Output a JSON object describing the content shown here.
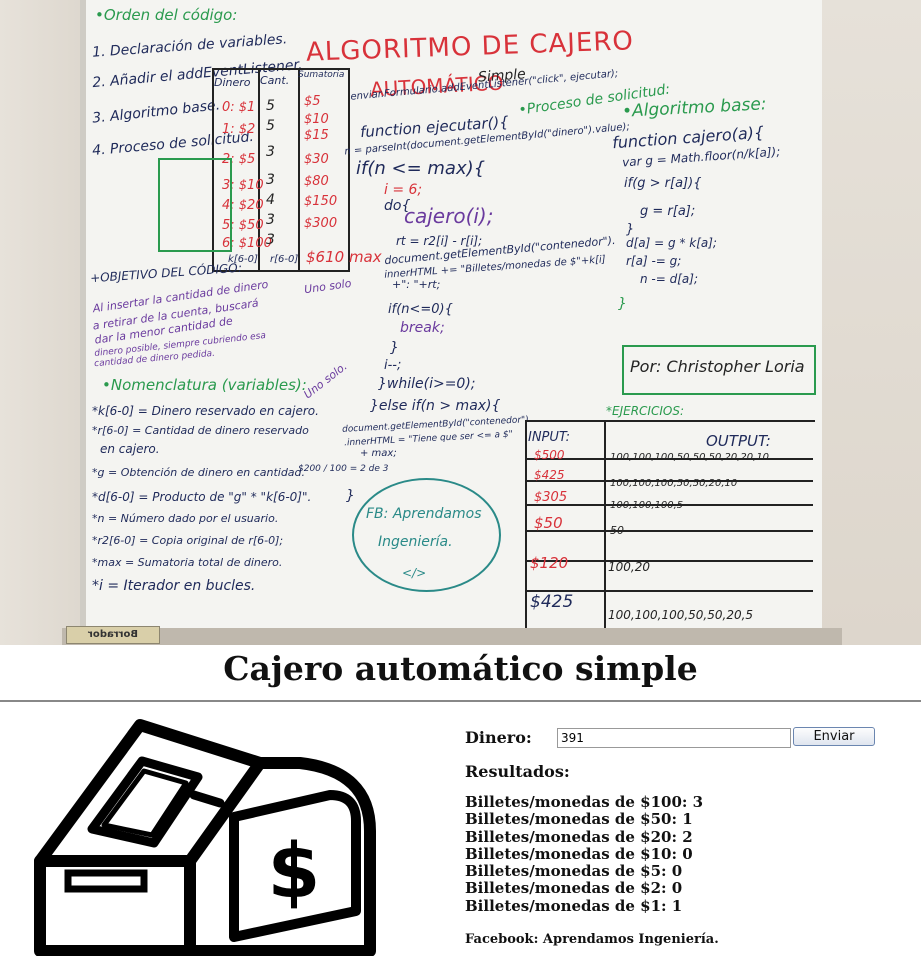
{
  "whiteboard": {
    "main_title": "ALGORITMO DE CAJERO",
    "subtitle_red": "AUTOMÁTICO",
    "subtitle_dark": "Simple",
    "code_order_heading": "•Orden del código:",
    "steps": [
      "1. Declaración de variables.",
      "2. Añadir el addEventListener.",
      "3. Algoritmo base.",
      "4. Proceso de solicitud."
    ],
    "mini_table": {
      "headers": [
        "Dinero",
        "Cant.",
        "Sumatoria"
      ],
      "rows": [
        [
          "0: $1",
          "5",
          "$5"
        ],
        [
          "1: $2",
          "5",
          "$10"
        ],
        [
          "",
          "",
          "$15"
        ],
        [
          "2: $5",
          "3",
          "$30"
        ],
        [
          "3: $10",
          "3",
          "$80"
        ],
        [
          "4: $20",
          "4",
          "$150"
        ],
        [
          "5: $50",
          "3",
          "$300"
        ],
        [
          "6: $100",
          "3",
          ""
        ]
      ],
      "footer": [
        "k[6-0]",
        "r[6-0]",
        "$610 max"
      ]
    },
    "listener_code": [
      "enviar.Formulario.addEventListener(\"click\", ejecutar);",
      "function ejecutar(){",
      "n = parseInt(document.getElementById(\"dinero\").value);",
      "if(n <= max){",
      "i = 6;",
      "do{",
      "cajero(i);",
      "rt = r2[i] - r[i];",
      "document.getElementById(\"contenedor\").",
      "innerHTML += \"Billetes/monedas de $\"+k[i]",
      "+\": \"+rt;",
      "if(n<=0){",
      "break;",
      "}",
      "i--;",
      "}while(i>=0);",
      "}else if(n > max){",
      "document.getElementById(\"contenedor\")",
      ".innerHTML = \"Tiene que ser <= a $\"",
      "+ max;",
      "}"
    ],
    "process_note": "•Proceso de solicitud:",
    "solo_note_1": "Uno solo",
    "solo_note_2": "Uno solo.",
    "algo_base_heading": "•Algoritmo base:",
    "algo_base_code": [
      "function cajero(a){",
      "var g = Math.floor(n/k[a]);",
      "if(g > r[a]){",
      "g = r[a];",
      "}",
      "d[a] = g * k[a];",
      "r[a] -= g;",
      "n -= d[a];",
      "}"
    ],
    "objective_heading": "+OBJETIVO DEL CÓDIGO:",
    "objective_text": [
      "Al insertar la cantidad de dinero",
      "a retirar de la cuenta, buscará",
      "dar la menor cantidad de",
      "dinero posible, siempre cubriendo esa",
      "cantidad de dinero pedida."
    ],
    "nomenclature_heading": "•Nomenclatura (variables):",
    "nomenclature_items": [
      "*k[6-0] = Dinero reservado en cajero.",
      "*r[6-0] = Cantidad de dinero reservado",
      "en cajero.",
      "*g = Obtención de dinero en cantidad.",
      "*d[6-0] = Producto de \"g\" * \"k[6-0]\".",
      "*n = Número dado por el usuario.",
      "*r2[6-0] = Copia original de r[6-0];",
      "*max = Sumatoria total de dinero.",
      "*i = Iterador en bucles."
    ],
    "g_example": "$200 / 100 = 2 de 3",
    "author": "Por: Christopher Loria",
    "fb_bubble": [
      "FB: Aprendamos",
      "Ingeniería.",
      "</>"
    ],
    "exercises_heading": "*EJERCICIOS:",
    "exercises": {
      "headers": [
        "INPUT:",
        "OUTPUT:"
      ],
      "rows": [
        [
          "$500",
          "100,100,100,50,50,50,20,20,10"
        ],
        [
          "$425",
          "100,100,100,50,50,20,10"
        ],
        [
          "$305",
          "100,100,100,5"
        ],
        [
          "$50",
          "50"
        ],
        [
          "$120",
          "100,20"
        ],
        [
          "$425",
          "100,100,100,50,50,20,5"
        ]
      ]
    },
    "eraser_label": "Borrador"
  },
  "webpage": {
    "title": "Cajero automático simple",
    "form": {
      "label": "Dinero:",
      "input_value": "391",
      "button_label": "Enviar"
    },
    "results_heading": "Resultados:",
    "results": [
      "Billetes/monedas de $100: 3",
      "Billetes/monedas de $50: 1",
      "Billetes/monedas de $20: 2",
      "Billetes/monedas de $10: 0",
      "Billetes/monedas de $5: 0",
      "Billetes/monedas de $2: 0",
      "Billetes/monedas de $1: 1"
    ],
    "footer": "Facebook: Aprendamos Ingeniería.",
    "atm_symbol": "$"
  },
  "colors": {
    "marker_green": "#2a9a4e",
    "marker_blue": "#1f2a5a",
    "marker_red": "#d8323a",
    "marker_purple": "#6a3a9e",
    "marker_teal": "#2a8a88",
    "board_white": "#f4f4f1"
  },
  "icons": [
    "atm-machine-icon",
    "dollar-sign-icon"
  ]
}
